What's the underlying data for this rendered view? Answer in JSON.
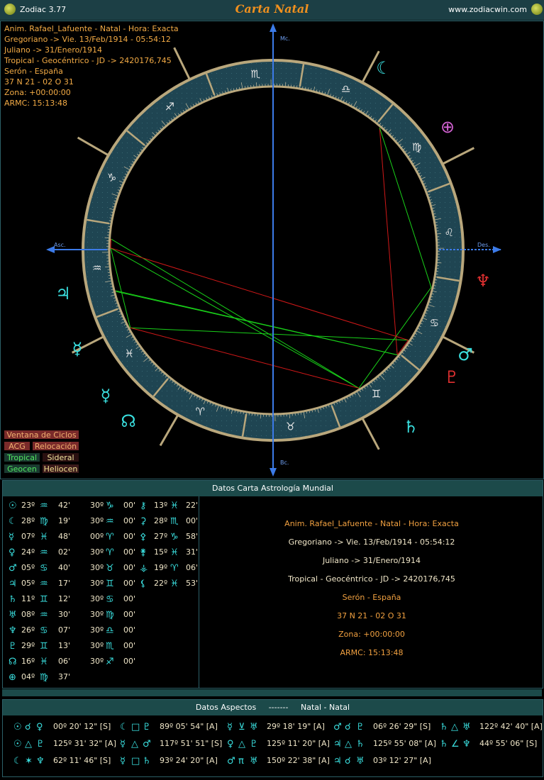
{
  "titlebar": {
    "app": "Zodiac 3.77",
    "title": "Carta Natal",
    "url": "www.zodiacwin.com"
  },
  "chart_info": [
    "Anim. Rafael_Lafuente - Natal - Hora: Exacta",
    "Gregoriano -> Vie. 13/Feb/1914 - 05:54:12",
    "Juliano -> 31/Enero/1914",
    "Tropical - Geocéntrico - JD -> 2420176,745",
    "Serón - España",
    "37 N 21 - 02 O 31",
    "Zona: +00:00:00",
    "ARMC: 15:13:48"
  ],
  "axes": {
    "mc": "Mc.",
    "ic": "Bc.",
    "asc": "Asc.",
    "des": "Des."
  },
  "buttons": {
    "ciclos": "Ventana de Ciclos",
    "acg": "ACG",
    "relocacion": "Relocación",
    "tropical": "Tropical",
    "sideral": "Sideral",
    "geocen": "Geocen",
    "heliocen": "Heliocen"
  },
  "panel_mundial": {
    "title": "Datos Carta Astrología Mundial",
    "planets": [
      {
        "g": "☉",
        "deg": "23º",
        "sg": "♒",
        "min": "42'"
      },
      {
        "g": "☾",
        "deg": "28º",
        "sg": "♍",
        "min": "19'"
      },
      {
        "g": "☿",
        "deg": "07º",
        "sg": "♓",
        "min": "48'"
      },
      {
        "g": "♀",
        "deg": "24º",
        "sg": "♒",
        "min": "02'"
      },
      {
        "g": "♂",
        "deg": "05º",
        "sg": "♋",
        "min": "40'"
      },
      {
        "g": "♃",
        "deg": "05º",
        "sg": "♒",
        "min": "17'"
      },
      {
        "g": "♄",
        "deg": "11º",
        "sg": "♊",
        "min": "12'"
      },
      {
        "g": "♅",
        "deg": "08º",
        "sg": "♒",
        "min": "30'"
      },
      {
        "g": "♆",
        "deg": "26º",
        "sg": "♋",
        "min": "07'"
      },
      {
        "g": "♇",
        "deg": "29º",
        "sg": "♊",
        "min": "13'"
      },
      {
        "g": "☊",
        "deg": "16º",
        "sg": "♓",
        "min": "06'"
      },
      {
        "g": "⊕",
        "deg": "04º",
        "sg": "♍",
        "min": "37'"
      }
    ],
    "houses": [
      {
        "deg": "30º",
        "sg": "♑",
        "min": "00'"
      },
      {
        "deg": "30º",
        "sg": "♒",
        "min": "00'"
      },
      {
        "deg": "00º",
        "sg": "♈",
        "min": "00'"
      },
      {
        "deg": "30º",
        "sg": "♈",
        "min": "00'"
      },
      {
        "deg": "30º",
        "sg": "♉",
        "min": "00'"
      },
      {
        "deg": "30º",
        "sg": "♊",
        "min": "00'"
      },
      {
        "deg": "30º",
        "sg": "♋",
        "min": "00'"
      },
      {
        "deg": "30º",
        "sg": "♍",
        "min": "00'"
      },
      {
        "deg": "30º",
        "sg": "♎",
        "min": "00'"
      },
      {
        "deg": "30º",
        "sg": "♏",
        "min": "00'"
      },
      {
        "deg": "30º",
        "sg": "♐",
        "min": "00'"
      }
    ],
    "asteroids": [
      {
        "g": "⚷",
        "deg": "13º",
        "sg": "♓",
        "min": "22'"
      },
      {
        "g": "⚳",
        "deg": "28º",
        "sg": "♏",
        "min": "00'"
      },
      {
        "g": "⚴",
        "deg": "27º",
        "sg": "♑",
        "min": "58'"
      },
      {
        "g": "⚵",
        "deg": "15º",
        "sg": "♓",
        "min": "31'"
      },
      {
        "g": "⚶",
        "deg": "19º",
        "sg": "♈",
        "min": "06'"
      },
      {
        "g": "⚸",
        "deg": "22º",
        "sg": "♓",
        "min": "53'"
      }
    ]
  },
  "panel_aspects": {
    "title": "Datos Aspectos",
    "sep": "-------",
    "subtitle": "Natal - Natal",
    "aspects": [
      {
        "a": "☉",
        "asp": "☌",
        "b": "♀",
        "val": "00º 20' 12\" [S]"
      },
      {
        "a": "☾",
        "asp": "□",
        "b": "♇",
        "val": "89º 05' 54\" [A]"
      },
      {
        "a": "☿",
        "asp": "⊻",
        "b": "♅",
        "val": "29º 18' 19\" [A]"
      },
      {
        "a": "♂",
        "asp": "☌",
        "b": "♇",
        "val": "06º 26' 29\" [S]"
      },
      {
        "a": "♄",
        "asp": "△",
        "b": "♅",
        "val": "122º 42' 40\" [A]"
      },
      {
        "a": "☉",
        "asp": "△",
        "b": "♇",
        "val": "125º 31' 32\" [A]"
      },
      {
        "a": "☿",
        "asp": "△",
        "b": "♂",
        "val": "117º 51' 51\" [S]"
      },
      {
        "a": "♀",
        "asp": "△",
        "b": "♇",
        "val": "125º 11' 20\" [A]"
      },
      {
        "a": "♃",
        "asp": "△",
        "b": "♄",
        "val": "125º 55' 08\" [A]"
      },
      {
        "a": "♄",
        "asp": "∠",
        "b": "♆",
        "val": "44º 55' 06\" [S]"
      },
      {
        "a": "☾",
        "asp": "✶",
        "b": "♆",
        "val": "62º 11' 46\" [S]"
      },
      {
        "a": "☿",
        "asp": "□",
        "b": "♄",
        "val": "93º 24' 20\" [A]"
      },
      {
        "a": "♂",
        "asp": "π",
        "b": "♅",
        "val": "150º 22' 38\" [A]"
      },
      {
        "a": "♃",
        "asp": "☌",
        "b": "♅",
        "val": "03º 12' 27\" [A]"
      }
    ]
  },
  "colors": {
    "background": "#000000",
    "ring": "#1f4552",
    "ring_border": "#b9a77c",
    "axis_blue": "#3c7be8",
    "glyph_cyan": "#3ae0e0",
    "info_orange": "#f3ab45",
    "line_red": "#d01818",
    "line_green": "#19d019"
  }
}
